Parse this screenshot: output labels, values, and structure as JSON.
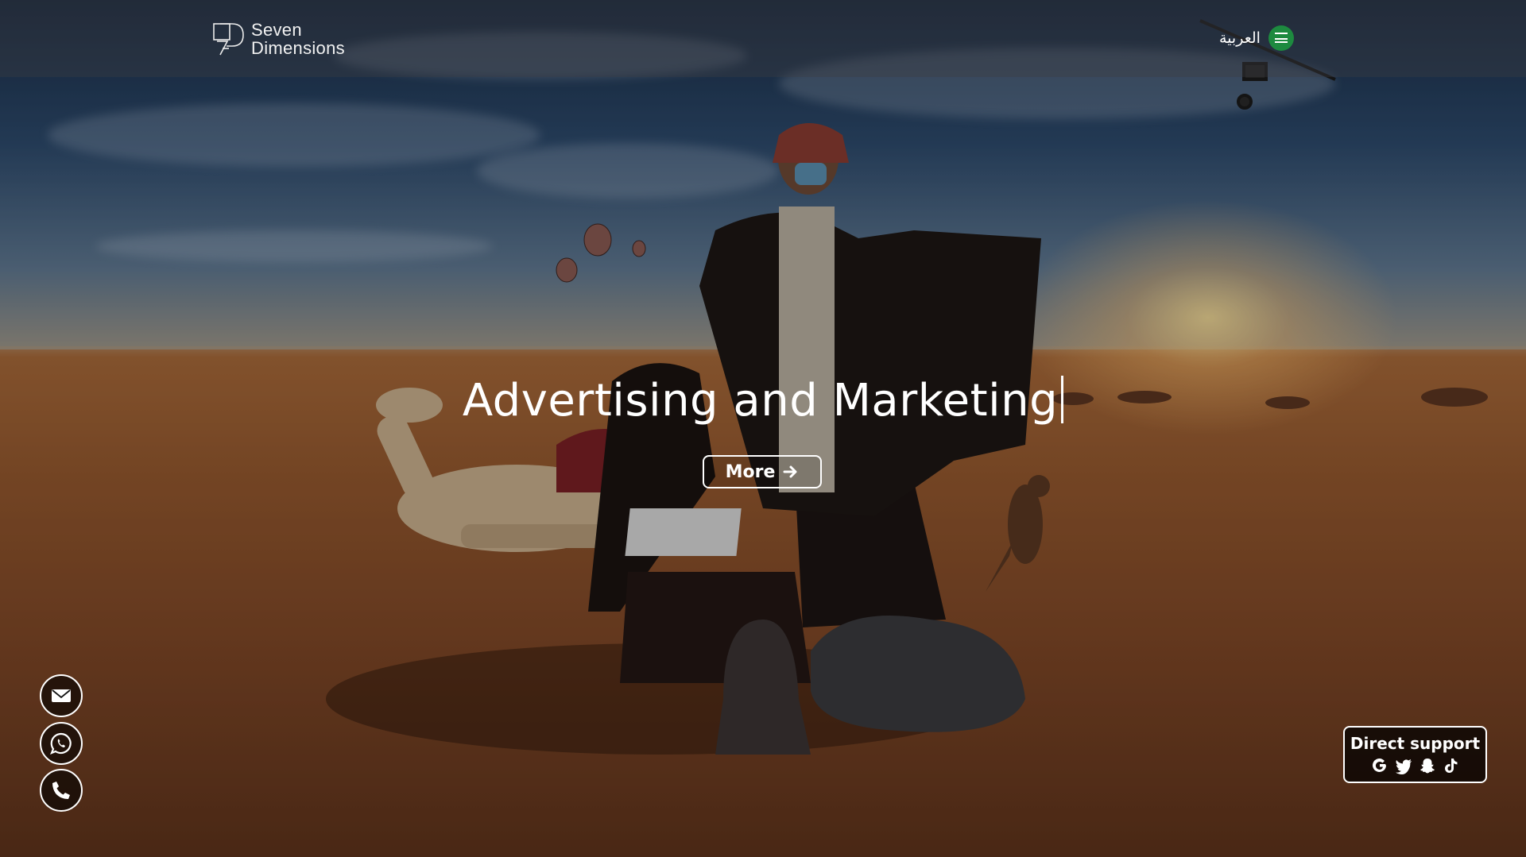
{
  "header": {
    "logo_line1": "Seven",
    "logo_line2": "Dimensions",
    "language_label": "العربية",
    "language_flag_icon": "saudi-flag-icon"
  },
  "hero": {
    "headline": "Advertising and Marketing",
    "more_button_label": "More",
    "more_button_icon": "arrow-right-icon"
  },
  "contact_buttons": [
    {
      "icon": "envelope-icon"
    },
    {
      "icon": "whatsapp-icon"
    },
    {
      "icon": "phone-icon"
    }
  ],
  "direct_support": {
    "label": "Direct support",
    "icons": [
      "google-icon",
      "twitter-icon",
      "snapchat-icon",
      "tiktok-icon"
    ]
  },
  "colors": {
    "flag_green": "#1d8a3f",
    "button_border": "#ffffff"
  }
}
